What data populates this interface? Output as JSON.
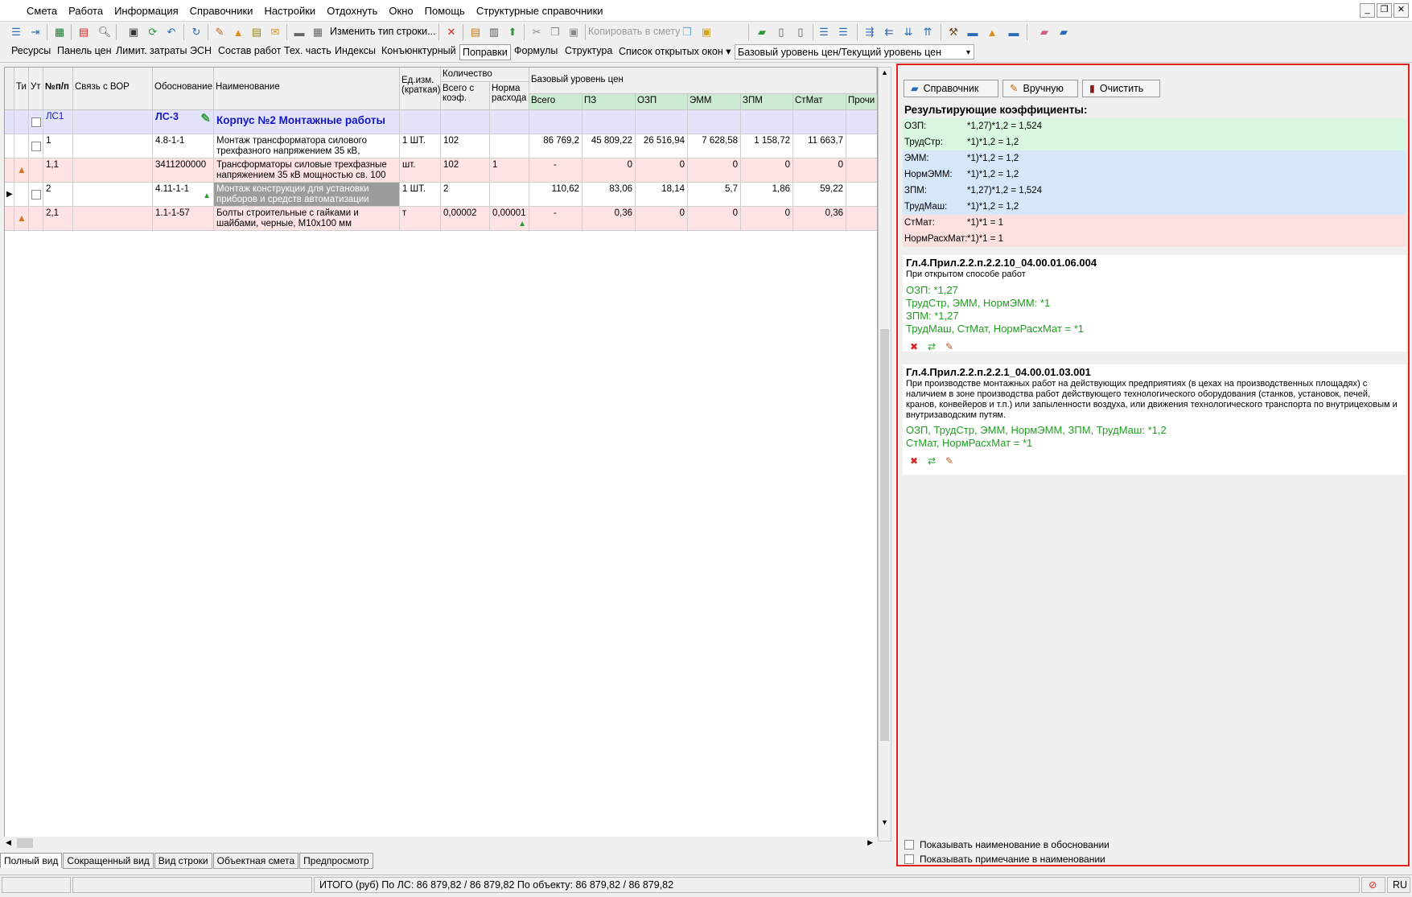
{
  "menu": [
    "Смета",
    "Работа",
    "Информация",
    "Справочники",
    "Настройки",
    "Отдохнуть",
    "Окно",
    "Помощь",
    "Структурные справочники"
  ],
  "toolbar": {
    "change_row_type": "Изменить тип строки...",
    "copy_to_estimate": "Копировать в смету"
  },
  "tabs": [
    "Ресурсы",
    "Панель цен",
    "Лимит. затраты",
    "ЭСН",
    "Состав работ",
    "Тех. часть",
    "Индексы",
    "Конъюнктурный",
    "Поправки",
    "Формулы",
    "Структура",
    "Список открытых окон"
  ],
  "active_tab": "Поправки",
  "price_level_select": "Базовый уровень цен/Текущий уровень цен",
  "grid": {
    "headers": {
      "ti": "Ти",
      "ut": "Ут",
      "num": "№п/п",
      "vor": "Связь с ВОР",
      "basis": "Обоснование",
      "name": "Наименование",
      "unit": "Ед.изм. (краткая)",
      "qty_group": "Количество",
      "qty_total": "Всего с коэф.",
      "qty_norm": "Норма расхода",
      "price_group": "Базовый уровень цен",
      "total": "Всего",
      "pz": "ПЗ",
      "ozp": "ОЗП",
      "emm": "ЭММ",
      "zpm": "ЗПМ",
      "stmat": "СтМат",
      "other": "Прочи"
    },
    "rows": [
      {
        "num": "ЛС1",
        "basis": "ЛС-3",
        "name": "Корпус №2 Монтажные работы",
        "unit": "",
        "qty_total": "",
        "qty_norm": "",
        "total": "",
        "pz": "",
        "ozp": "",
        "emm": "",
        "zpm": "",
        "stmat": ""
      },
      {
        "num": "1",
        "basis": "4.8-1-1",
        "name": "Монтаж трансформатора силового трехфазного напряжением 35 кВ,",
        "unit": "1 ШТ.",
        "qty_total": "102",
        "qty_norm": "",
        "total": "86 769,2",
        "pz": "45 809,22",
        "ozp": "26 516,94",
        "emm": "7 628,58",
        "zpm": "1 158,72",
        "stmat": "11 663,7"
      },
      {
        "num": "1,1",
        "basis": "3411200000",
        "name": "Трансформаторы силовые трехфазные напряжением 35 кВ мощностью св. 100",
        "unit": "шт.",
        "qty_total": "102",
        "qty_norm": "1",
        "total": "-",
        "pz": "0",
        "ozp": "0",
        "emm": "0",
        "zpm": "0",
        "stmat": "0"
      },
      {
        "num": "2",
        "basis": "4.11-1-1",
        "name": "Монтаж конструкции для установки приборов и средств автоматизации массой",
        "unit": "1 ШТ.",
        "qty_total": "2",
        "qty_norm": "",
        "total": "110,62",
        "pz": "83,06",
        "ozp": "18,14",
        "emm": "5,7",
        "zpm": "1,86",
        "stmat": "59,22"
      },
      {
        "num": "2,1",
        "basis": "1.1-1-57",
        "name": "Болты строительные с гайками и шайбами, черные, М10х100 мм",
        "unit": "т",
        "qty_total": "0,00002",
        "qty_norm": "0,00001",
        "total": "-",
        "pz": "0,36",
        "ozp": "0",
        "emm": "0",
        "zpm": "0",
        "stmat": "0,36"
      }
    ]
  },
  "view_tabs": [
    "Полный вид",
    "Сокращенный вид",
    "Вид строки",
    "Объектная смета",
    "Предпросмотр"
  ],
  "status": {
    "total": "ИТОГО (руб)  По ЛС: 86 879,82 / 86 879,82     По объекту: 86 879,82 / 86 879,82",
    "lang": "RU"
  },
  "panel": {
    "buttons": {
      "reference": "Справочник",
      "manual": "Вручную",
      "clear": "Очистить"
    },
    "result_title": "Результирующие коэффициенты:",
    "coefs": [
      {
        "k": "ОЗП:",
        "v": "*1,27)*1,2 = 1,524",
        "color": "#d9f7e0"
      },
      {
        "k": "ТрудСтр:",
        "v": "*1)*1,2 = 1,2",
        "color": "#d9f7e0"
      },
      {
        "k": "ЭММ:",
        "v": "*1)*1,2 = 1,2",
        "color": "#d6e8f7"
      },
      {
        "k": "НормЭММ:",
        "v": "*1)*1,2 = 1,2",
        "color": "#d6e8f7"
      },
      {
        "k": "ЗПМ:",
        "v": "*1,27)*1,2 = 1,524",
        "color": "#d6e8f7"
      },
      {
        "k": "ТрудМаш:",
        "v": "*1)*1,2 = 1,2",
        "color": "#d6e8f7"
      },
      {
        "k": "СтМат:",
        "v": "*1)*1 = 1",
        "color": "#fbe0e0"
      },
      {
        "k": "НормРасхМат:",
        "v": "*1)*1 = 1",
        "color": "#fbe0e0"
      }
    ],
    "sections": [
      {
        "title": "Гл.4.Прил.2.2.п.2.2.10_04.00.01.06.004",
        "desc": "При открытом способе работ",
        "lines": [
          "ОЗП: *1,27",
          "ТрудСтр, ЭММ, НормЭММ: *1",
          "ЗПМ: *1,27",
          "ТрудМаш, СтМат, НормРасхМат = *1"
        ]
      },
      {
        "title": "Гл.4.Прил.2.2.п.2.2.1_04.00.01.03.001",
        "desc": "При производстве монтажных работ на действующих предприятиях (в цехах на производственных площадях) с наличием в зоне производства работ действующего технологического оборудования (станков, установок, печей, кранов, конвейеров и т.п.) или запыленности воздуха, или движения технологического транспорта по внутрицеховым и внутризаводским путям.",
        "lines": [
          "ОЗП, ТрудСтр, ЭММ, НормЭММ, ЗПМ, ТрудМаш: *1,2",
          "СтМат, НормРасхМат = *1"
        ]
      }
    ],
    "options": [
      "Показывать наименование в обосновании",
      "Показывать примечание в наименовании"
    ]
  }
}
